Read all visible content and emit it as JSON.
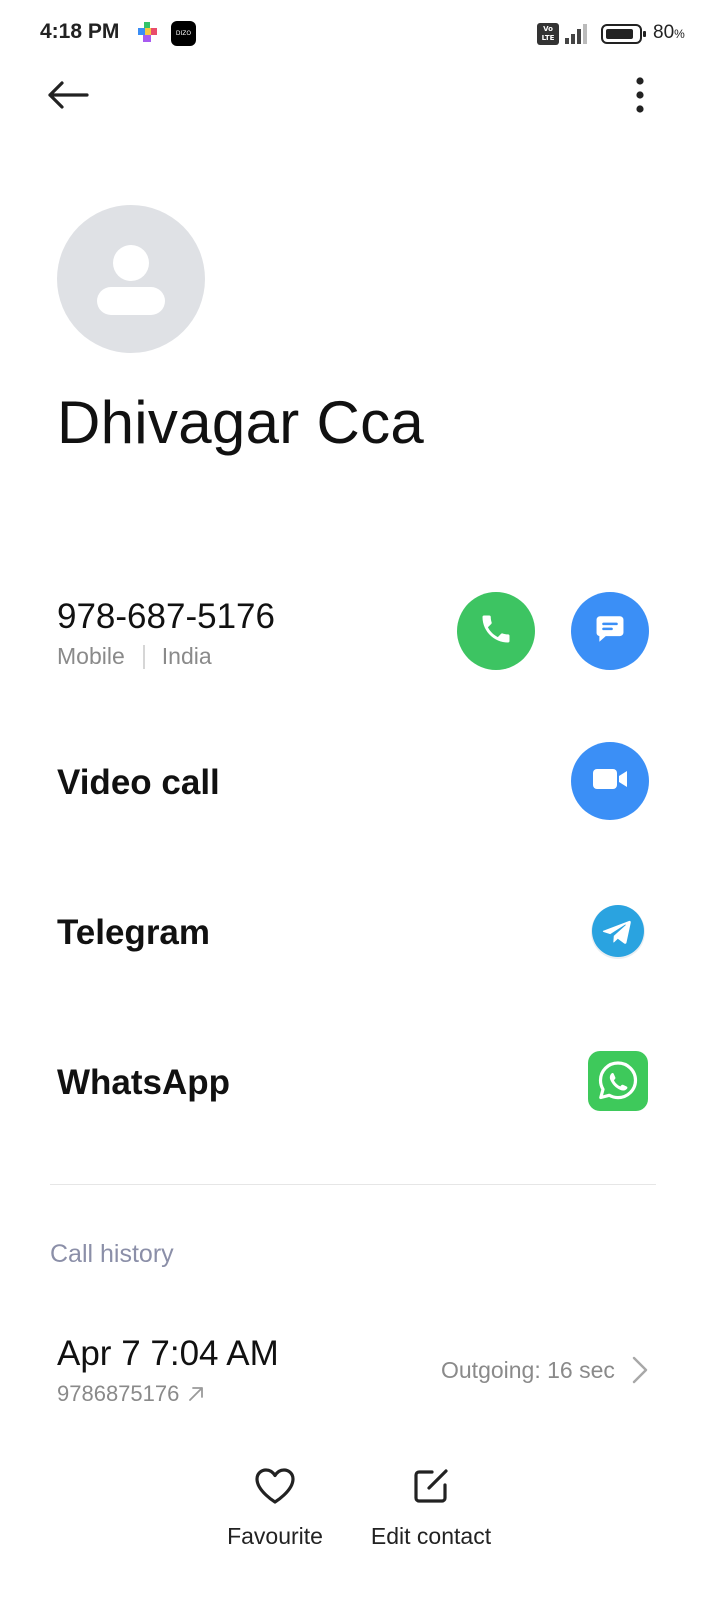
{
  "status_bar": {
    "time": "4:18 PM",
    "app_icon_1": "colorful-puzzle-icon",
    "app_icon_2_label": "DIZO",
    "volte_label": "Vo\nLTE",
    "signal_icon": "signal-icon",
    "battery_icon": "battery-icon",
    "battery_value": "80",
    "battery_unit": "%"
  },
  "toolbar": {
    "back_icon": "back-arrow-icon",
    "more_icon": "more-vert-icon"
  },
  "contact": {
    "avatar_icon": "person-icon",
    "name": "Dhivagar Cca"
  },
  "phone": {
    "number": "978-687-5176",
    "type": "Mobile",
    "region": "India",
    "call_icon": "phone-icon",
    "message_icon": "message-icon"
  },
  "actions": {
    "video_call_label": "Video call",
    "video_icon": "video-camera-icon",
    "telegram_label": "Telegram",
    "telegram_icon": "telegram-icon",
    "whatsapp_label": "WhatsApp",
    "whatsapp_icon": "whatsapp-icon"
  },
  "call_history": {
    "header": "Call history",
    "entries": [
      {
        "datetime": "Apr 7 7:04 AM",
        "number": "9786875176",
        "direction_icon": "outgoing-arrow-icon",
        "status": "Outgoing: 16 sec"
      }
    ]
  },
  "bottom_bar": {
    "favourite_label": "Favourite",
    "favourite_icon": "heart-icon",
    "edit_label": "Edit contact",
    "edit_icon": "edit-icon"
  },
  "colors": {
    "call_green": "#3dc462",
    "action_blue": "#3b8ff6",
    "telegram_blue": "#2aa3e0",
    "whatsapp_green": "#3ec95b",
    "avatar_bg": "#dfe1e5",
    "section_header": "#8b8fa8"
  }
}
